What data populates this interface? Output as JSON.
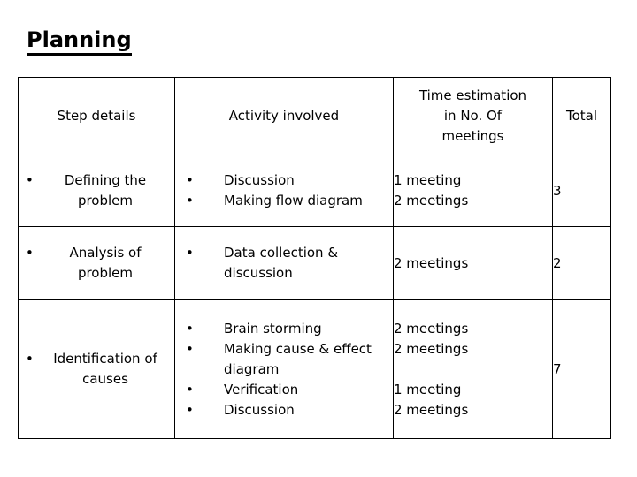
{
  "slide": {
    "title": "Planning"
  },
  "table": {
    "headers": {
      "step_details": "Step details",
      "activity_involved": "Activity involved",
      "time_estimation": "Time estimation in No. Of meetings",
      "time_estimation_line1": "Time estimation",
      "time_estimation_line2": "in No. Of",
      "time_estimation_line3": "meetings",
      "total": "Total"
    },
    "bullet_glyph": "•",
    "rows": [
      {
        "step": "Defining the problem",
        "activities": [
          "Discussion",
          "Making flow diagram"
        ],
        "times": [
          "1 meeting",
          "2 meetings"
        ],
        "total": "3"
      },
      {
        "step": "Analysis of problem",
        "activities": [
          "Data collection & discussion"
        ],
        "times": [
          "2 meetings"
        ],
        "total": "2"
      },
      {
        "step": "Identification of causes",
        "activities": [
          "Brain storming",
          "Making cause & effect diagram",
          "Verification",
          "Discussion"
        ],
        "times": [
          "2 meetings",
          "2 meetings",
          "",
          "1 meeting",
          "2 meetings"
        ],
        "total": "7"
      }
    ]
  },
  "colors": {
    "background": "#ffffff",
    "text": "#000000",
    "border": "#000000"
  }
}
